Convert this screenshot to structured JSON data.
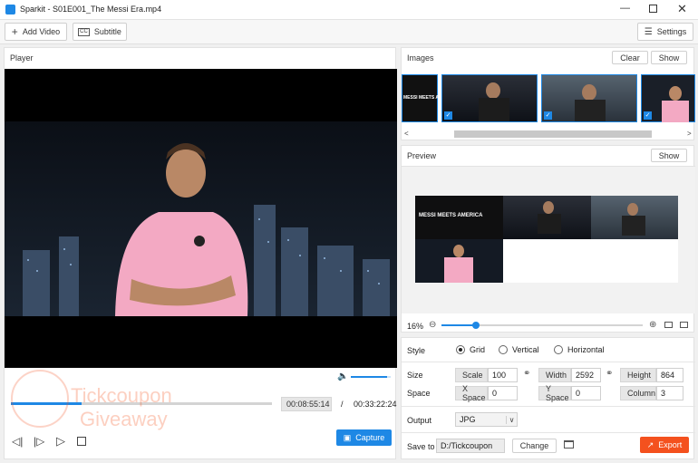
{
  "window": {
    "title": "Sparkit - S01E001_The Messi Era.mp4"
  },
  "toolbar": {
    "add_video": "Add Video",
    "subtitle": "Subtitle",
    "settings": "Settings"
  },
  "player": {
    "label": "Player",
    "current_time": "00:08:55:14",
    "separator": "/",
    "total_time": "00:33:22:24",
    "capture": "Capture",
    "progress": 0.27,
    "volume": 0.9
  },
  "images": {
    "label": "Images",
    "clear": "Clear",
    "show": "Show",
    "thumb_caption": "MESSI MEETS AMERICA"
  },
  "preview": {
    "label": "Preview",
    "show": "Show",
    "zoom": "16%",
    "zoom_level": 0.17,
    "title_text": "MESSI MEETS AMERICA"
  },
  "style": {
    "label": "Style",
    "options": [
      "Grid",
      "Vertical",
      "Horizontal"
    ],
    "selected": "Grid"
  },
  "size": {
    "label": "Size",
    "scale_label": "Scale",
    "scale": "100",
    "width_label": "Width",
    "width": "2592",
    "height_label": "Height",
    "height": "864"
  },
  "space": {
    "label": "Space",
    "x_label": "X Space",
    "x": "0",
    "y_label": "Y Space",
    "y": "0",
    "column_label": "Column",
    "column": "3"
  },
  "output": {
    "label": "Output",
    "format": "JPG"
  },
  "save": {
    "label": "Save to",
    "path": "D:/Tickcoupon",
    "change": "Change",
    "export": "Export"
  },
  "watermark": {
    "line1": "Tickcoupon",
    "line2": "Giveaway"
  },
  "colors": {
    "accent": "#1e88e5",
    "export": "#f4511e",
    "jersey": "#f3a9c3"
  }
}
